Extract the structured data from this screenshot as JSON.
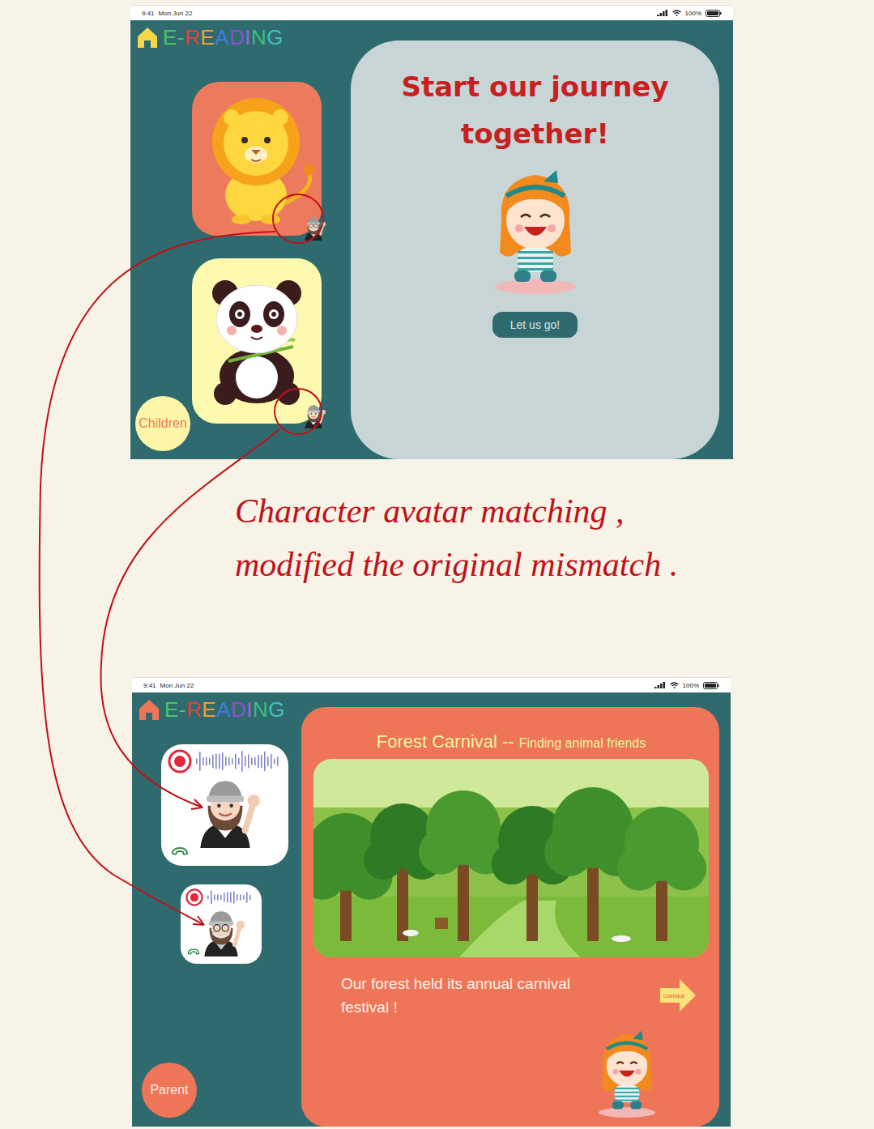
{
  "logo": {
    "letters": [
      {
        "char": "E",
        "color": "#4cc36a"
      },
      {
        "char": "-",
        "color": "#4cc36a"
      },
      {
        "char": "R",
        "color": "#e0403a"
      },
      {
        "char": "E",
        "color": "#f0a030"
      },
      {
        "char": "A",
        "color": "#3f7be0"
      },
      {
        "char": "D",
        "color": "#8e4fd0"
      },
      {
        "char": "I",
        "color": "#a064d4"
      },
      {
        "char": "N",
        "color": "#3fbf80"
      },
      {
        "char": "G",
        "color": "#3fc0c0"
      }
    ]
  },
  "status_bar": {
    "time": "9:41",
    "date": "Mon Jun 22",
    "battery": "100%"
  },
  "top_screen": {
    "character_cards": [
      {
        "kind": "lion",
        "color": "#ee7a5d"
      },
      {
        "kind": "panda",
        "color": "#fdfab0"
      }
    ],
    "role_button": "Children",
    "welcome": {
      "title_lines": [
        "Start our journey",
        "together!"
      ],
      "button": "Let us go!"
    }
  },
  "annotation": {
    "lines": [
      "Character avatar matching ,",
      "modified the original mismatch ."
    ]
  },
  "bottom_screen": {
    "calls": [
      {
        "kind": "waving"
      },
      {
        "kind": "masked"
      }
    ],
    "story": {
      "title": "Forest Carnival --",
      "subtitle": "Finding animal friends",
      "caption": "Our forest held its annual carnival festival !",
      "continue": "CONTINUE"
    },
    "role_button": "Parent"
  }
}
